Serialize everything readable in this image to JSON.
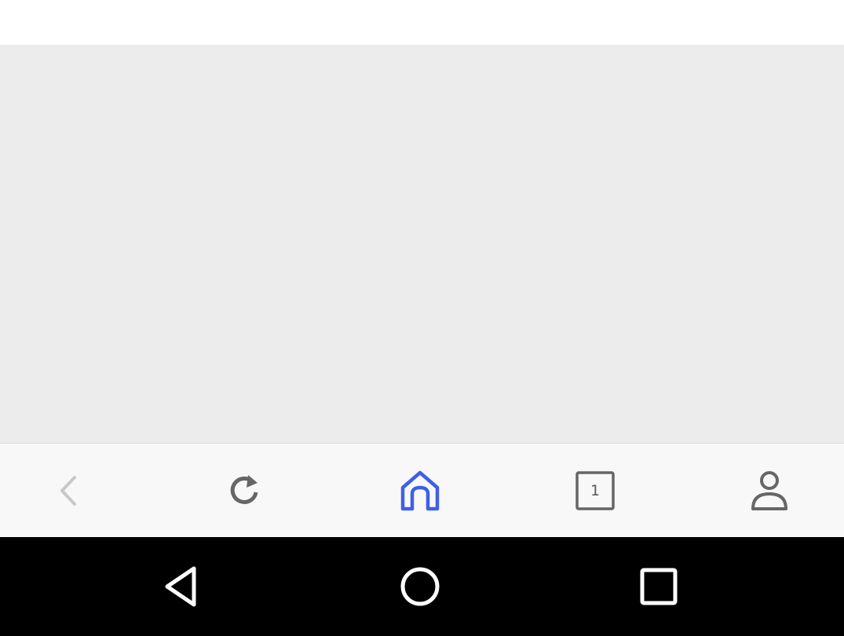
{
  "browser_toolbar": {
    "tab_count": "1",
    "active_item": "home",
    "colors": {
      "active": "#3f5fe8",
      "icon": "#666666",
      "disabled": "#c8c8c8",
      "background": "#f8f8f8"
    },
    "icons": [
      "chevron-left-icon",
      "reload-icon",
      "home-icon",
      "tabs-icon",
      "profile-icon"
    ]
  },
  "system_nav": {
    "icons": [
      "back-triangle-icon",
      "home-circle-icon",
      "recents-square-icon"
    ]
  },
  "colors": {
    "content_background": "#ececec",
    "top_bar": "#ffffff",
    "system_nav_background": "#000000"
  }
}
